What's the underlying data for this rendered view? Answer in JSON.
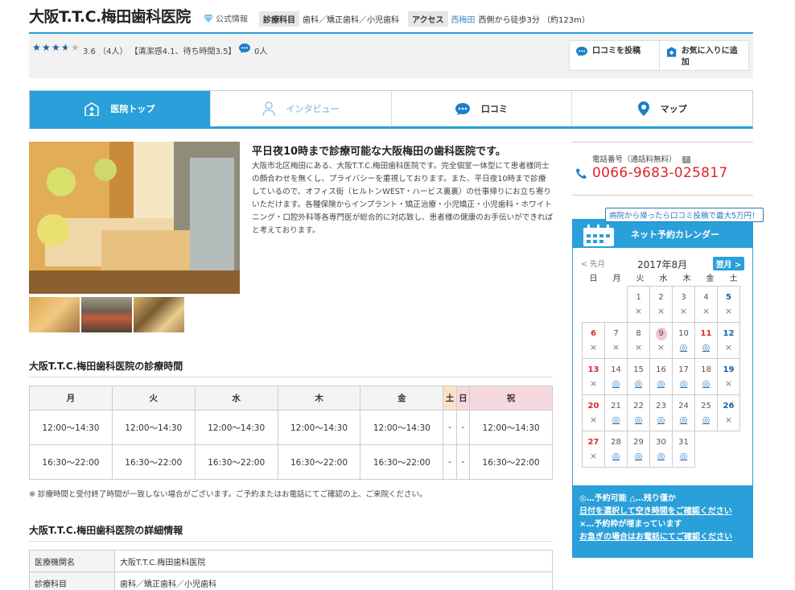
{
  "header": {
    "title": "大阪T.T.C.梅田歯科医院",
    "official": "公式情報",
    "specialty_label": "診療科目",
    "specialty_value": "歯科／矯正歯科／小児歯科",
    "access_label": "アクセス",
    "access_station": "西梅田",
    "access_value": "西側から徒歩3分 （約123m）"
  },
  "rating": {
    "stars": 3.6,
    "text": "3.6 （4人） 【清潔感4.1、待ち時間3.5】",
    "comment_count": "0人",
    "post_button": "口コミを投稿",
    "favorite_button": "お気に入りに追加"
  },
  "tabs": [
    {
      "label": "医院トップ"
    },
    {
      "label": "インタビュー"
    },
    {
      "label": "口コミ"
    },
    {
      "label": "マップ"
    }
  ],
  "intro": {
    "title": "平日夜10時まで診療可能な大阪梅田の歯科医院です。",
    "body": "大阪市北区梅田にある、大阪T.T.C.梅田歯科医院です。完全個室一体型にて患者様同士の顔合わせを無くし、プライバシーを重視しております。また、平日夜10時まで診療しているので、オフィス街（ヒルトンWEST・ハービス裏裏）の仕事帰りにお立ち寄りいただけます。各種保険からインプラント・矯正治療・小児矯正・小児歯科・ホワイトニング・口腔外科等各専門医が総合的に対応致し、患者様の健康のお手伝いができればと考えております。"
  },
  "hours": {
    "title": "大阪T.T.C.梅田歯科医院の診療時間",
    "days": [
      "月",
      "火",
      "水",
      "木",
      "金",
      "土",
      "日",
      "祝"
    ],
    "rows": [
      [
        "12:00～14:30",
        "12:00～14:30",
        "12:00～14:30",
        "12:00～14:30",
        "12:00～14:30",
        "-",
        "-",
        "12:00～14:30"
      ],
      [
        "16:30～22:00",
        "16:30～22:00",
        "16:30～22:00",
        "16:30～22:00",
        "16:30～22:00",
        "-",
        "-",
        "16:30～22:00"
      ]
    ],
    "note": "※ 診療時間と受付終了時間が一致しない場合がございます。ご予約またはお電話にてご確認の上、ご来院ください。"
  },
  "details": {
    "title": "大阪T.T.C.梅田歯科医院の詳細情報",
    "rows": [
      {
        "key": "医療機関名",
        "value": "大阪T.T.C.梅田歯科医院"
      },
      {
        "key": "診療科目",
        "value": "歯科／矯正歯科／小児歯科"
      }
    ]
  },
  "sidebar": {
    "phone_label": "電話番号（通話料無料）",
    "phone_number": "0066-9683-025817",
    "promo": "病院から帰ったら口コミ投稿で最大5万円！",
    "calendar_title": "ネット予約カレンダー",
    "prev_month": "< 先月",
    "month": "2017年8月",
    "next_month": "翌月 >",
    "weekdays": [
      "日",
      "月",
      "火",
      "水",
      "木",
      "金",
      "土"
    ],
    "ok_mark": "◎",
    "ng_mark": "×",
    "weeks": [
      [
        null,
        null,
        {
          "d": "1",
          "m": "x"
        },
        {
          "d": "2",
          "m": "x"
        },
        {
          "d": "3",
          "m": "x"
        },
        {
          "d": "4",
          "m": "x"
        },
        {
          "d": "5",
          "m": "x",
          "t": "sat"
        }
      ],
      [
        {
          "d": "6",
          "m": "x",
          "t": "sun"
        },
        {
          "d": "7",
          "m": "x"
        },
        {
          "d": "8",
          "m": "x"
        },
        {
          "d": "9",
          "m": "x",
          "t": "today"
        },
        {
          "d": "10",
          "m": "ok"
        },
        {
          "d": "11",
          "m": "ok",
          "t": "hol"
        },
        {
          "d": "12",
          "m": "x",
          "t": "sat"
        }
      ],
      [
        {
          "d": "13",
          "m": "x",
          "t": "sun"
        },
        {
          "d": "14",
          "m": "ok"
        },
        {
          "d": "15",
          "m": "ok"
        },
        {
          "d": "16",
          "m": "ok"
        },
        {
          "d": "17",
          "m": "ok"
        },
        {
          "d": "18",
          "m": "ok"
        },
        {
          "d": "19",
          "m": "x",
          "t": "sat"
        }
      ],
      [
        {
          "d": "20",
          "m": "x",
          "t": "sun"
        },
        {
          "d": "21",
          "m": "ok"
        },
        {
          "d": "22",
          "m": "ok"
        },
        {
          "d": "23",
          "m": "ok"
        },
        {
          "d": "24",
          "m": "ok"
        },
        {
          "d": "25",
          "m": "ok"
        },
        {
          "d": "26",
          "m": "x",
          "t": "sat"
        }
      ],
      [
        {
          "d": "27",
          "m": "x",
          "t": "sun"
        },
        {
          "d": "28",
          "m": "ok"
        },
        {
          "d": "29",
          "m": "ok"
        },
        {
          "d": "30",
          "m": "ok"
        },
        {
          "d": "31",
          "m": "ok"
        },
        null,
        null
      ]
    ],
    "legend_1": "◎…予約可能 △…残り僅か",
    "legend_2": "日付を選択して空き時間をご確認ください",
    "legend_3": "×…予約枠が埋まっています",
    "legend_4": "お急ぎの場合はお電話にてご確認ください"
  },
  "colors": {
    "accent": "#29a0da",
    "phone": "#e0262b",
    "link": "#2a7ac0"
  }
}
